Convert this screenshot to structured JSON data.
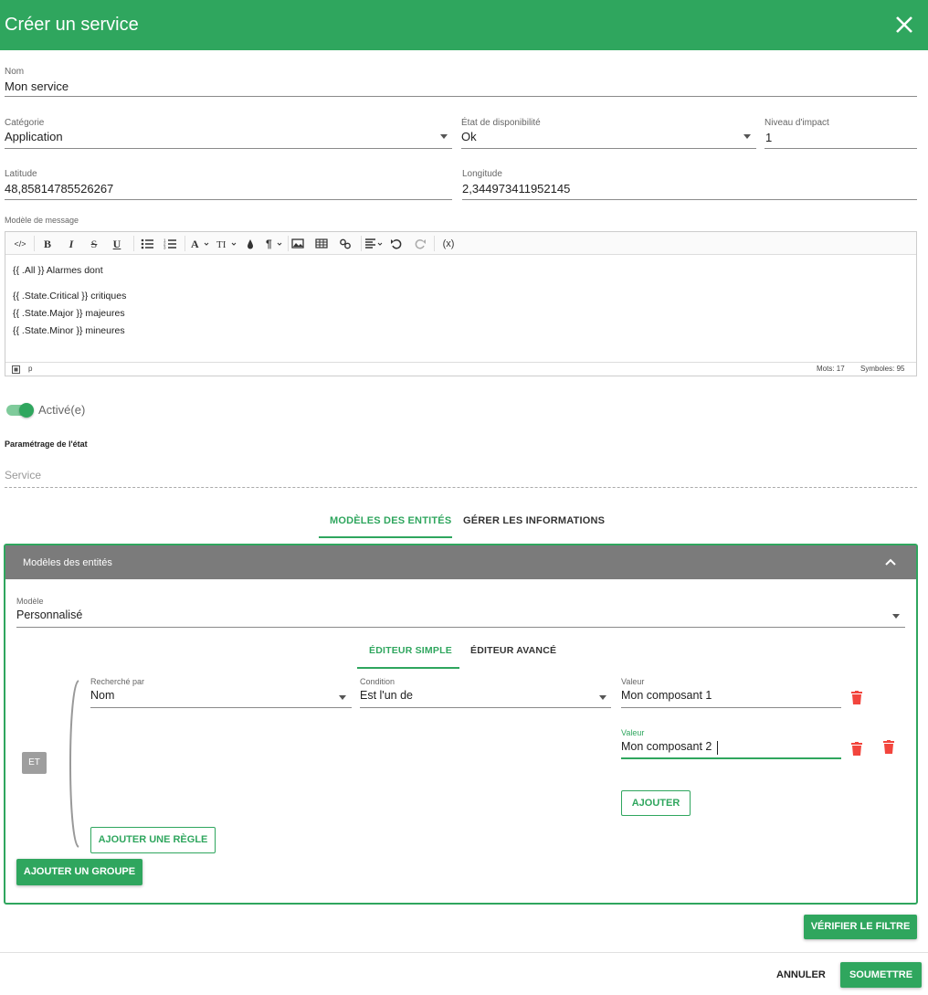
{
  "dialog": {
    "title": "Créer un service"
  },
  "fields": {
    "name": {
      "label": "Nom",
      "value": "Mon service"
    },
    "category": {
      "label": "Catégorie",
      "value": "Application"
    },
    "availability": {
      "label": "État de disponibilité",
      "value": "Ok"
    },
    "impact": {
      "label": "Niveau d'impact",
      "value": "1"
    },
    "latitude": {
      "label": "Latitude",
      "value": "48,85814785526267"
    },
    "longitude": {
      "label": "Longitude",
      "value": "2,344973411952145"
    }
  },
  "editor": {
    "label": "Modèle de message",
    "lines": [
      "{{ .All }} Alarmes dont",
      "{{ .State.Critical }} critiques",
      "{{ .State.Major }} majeures",
      "{{ .State.Minor }} mineures"
    ],
    "path": "p",
    "words": "Mots: 17",
    "symbols": "Symboles: 95",
    "toolbar": {
      "code": "</>",
      "bold": "B",
      "italic": "I",
      "strike": "S",
      "underline": "U",
      "variable": "(x)"
    }
  },
  "toggle": {
    "label": "Activé(e)"
  },
  "state_settings": {
    "heading": "Paramétrage de l'état",
    "placeholder": "Service"
  },
  "tabs": {
    "models": "MODÈLES DES ENTITÉS",
    "info": "GÉRER LES INFORMATIONS"
  },
  "panel": {
    "title": "Modèles des entités",
    "model": {
      "label": "Modèle",
      "value": "Personnalisé"
    },
    "subtabs": {
      "simple": "ÉDITEUR SIMPLE",
      "advanced": "ÉDITEUR AVANCÉ"
    },
    "group_op": "ET",
    "rule": {
      "searched_by": {
        "label": "Recherché par",
        "value": "Nom"
      },
      "condition": {
        "label": "Condition",
        "value": "Est l'un de"
      },
      "values": [
        {
          "label": "Valeur",
          "value": "Mon composant 1"
        },
        {
          "label": "Valeur",
          "value": "Mon composant 2"
        }
      ]
    },
    "add_value": "AJOUTER",
    "add_rule": "AJOUTER UNE RÈGLE",
    "add_group": "AJOUTER UN GROUPE"
  },
  "actions": {
    "verify": "VÉRIFIER LE FILTRE",
    "cancel": "ANNULER",
    "submit": "SOUMETTRE"
  },
  "colors": {
    "accent": "#2fa65e",
    "panel_header": "#7b7b7b",
    "delete": "#f2453d"
  }
}
